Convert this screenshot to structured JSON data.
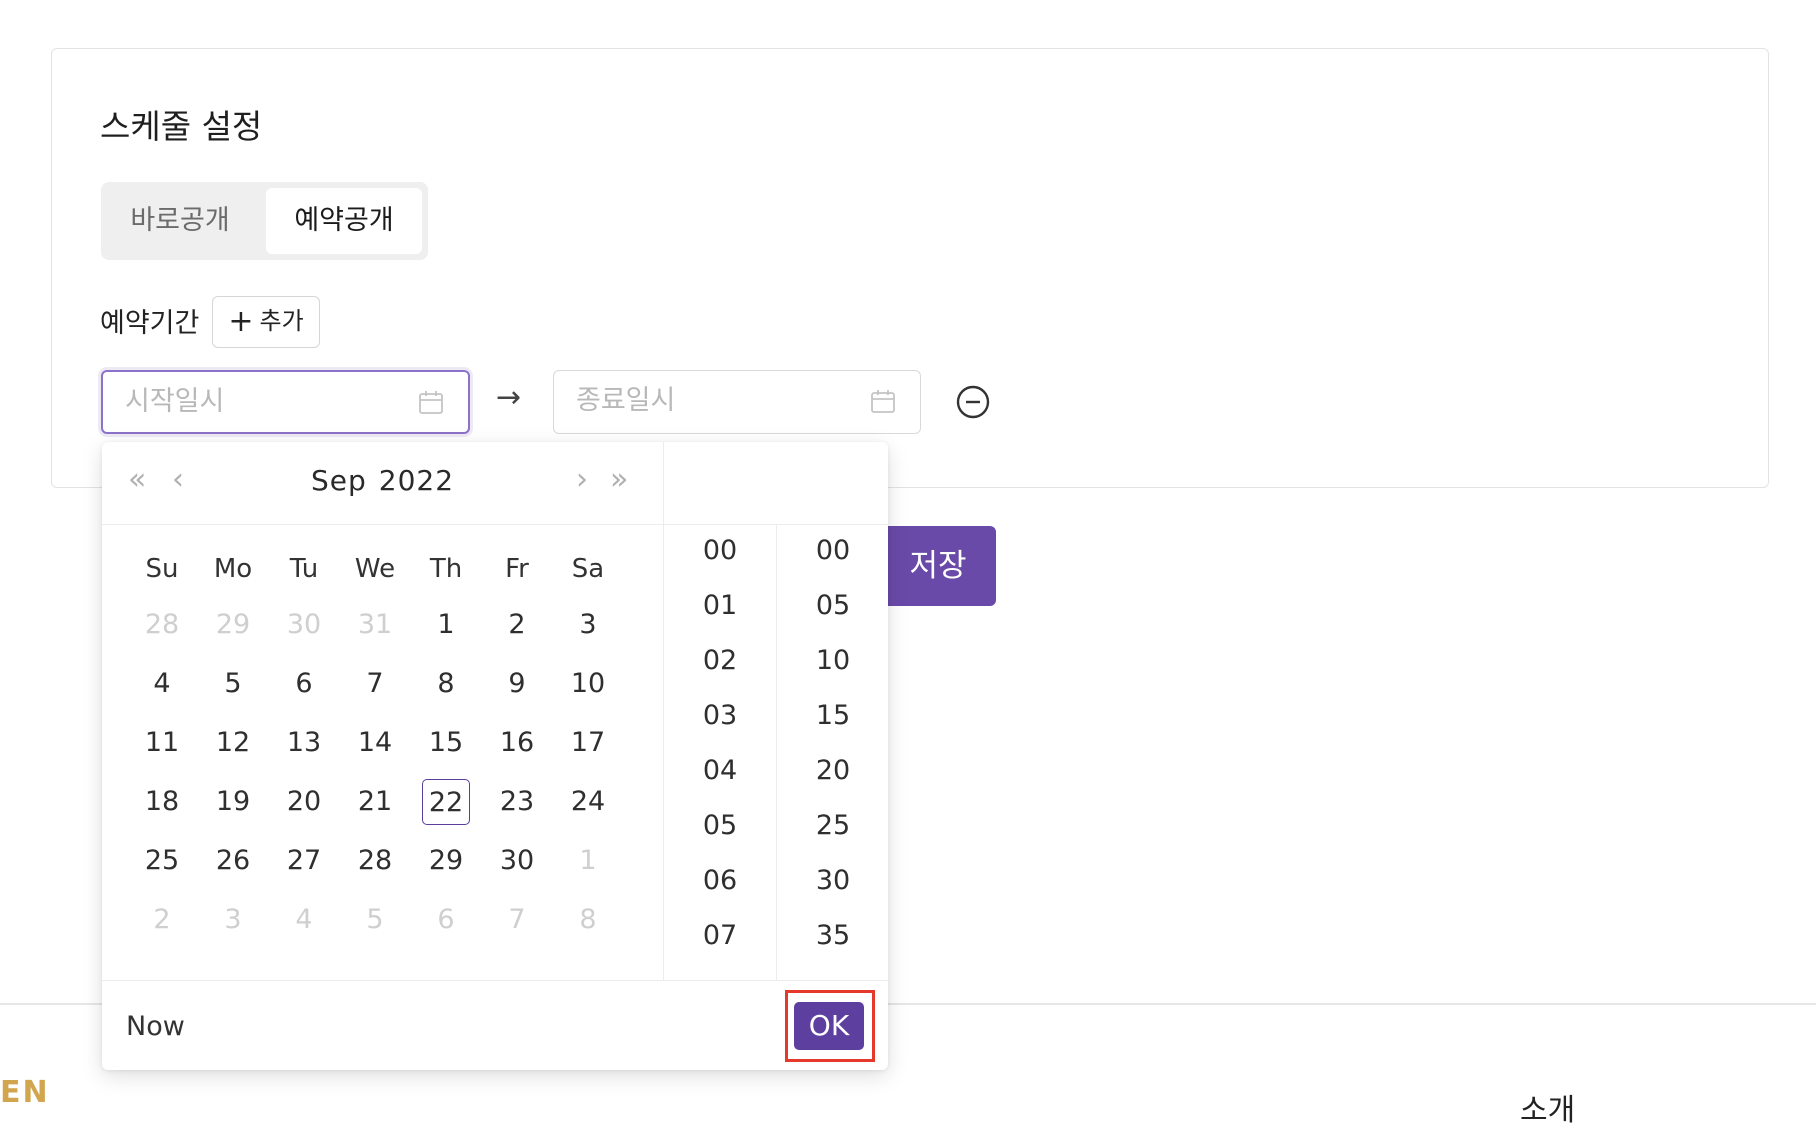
{
  "schedule": {
    "title": "스케줄 설정",
    "tabs": [
      {
        "label": "바로공개",
        "selected": false
      },
      {
        "label": "예약공개",
        "selected": true
      }
    ],
    "period_label": "예약기간",
    "add_button": {
      "icon": "plus-icon",
      "label": "추가"
    },
    "start_input": {
      "placeholder": "시작일시",
      "icon": "calendar-icon"
    },
    "range_separator": "→",
    "end_input": {
      "placeholder": "종료일시",
      "icon": "calendar-icon"
    },
    "remove_icon": "minus-circle-icon"
  },
  "save_button": {
    "label": "저장"
  },
  "picker": {
    "prev_year": "«",
    "prev_month": "‹",
    "month": "Sep",
    "year": "2022",
    "next_month": "›",
    "next_year": "»",
    "weekdays": [
      "Su",
      "Mo",
      "Tu",
      "We",
      "Th",
      "Fr",
      "Sa"
    ],
    "weeks": [
      [
        "28",
        "29",
        "30",
        "31",
        "1",
        "2",
        "3"
      ],
      [
        "4",
        "5",
        "6",
        "7",
        "8",
        "9",
        "10"
      ],
      [
        "11",
        "12",
        "13",
        "14",
        "15",
        "16",
        "17"
      ],
      [
        "18",
        "19",
        "20",
        "21",
        "22",
        "23",
        "24"
      ],
      [
        "25",
        "26",
        "27",
        "28",
        "29",
        "30",
        "1"
      ],
      [
        "2",
        "3",
        "4",
        "5",
        "6",
        "7",
        "8"
      ]
    ],
    "today": "22",
    "hours": [
      "00",
      "01",
      "02",
      "03",
      "04",
      "05",
      "06",
      "07"
    ],
    "minutes": [
      "00",
      "05",
      "10",
      "15",
      "20",
      "25",
      "30",
      "35"
    ],
    "now_label": "Now",
    "ok_label": "OK"
  },
  "colors": {
    "accent": "#6a4aa8",
    "highlight_box": "#e53a2b"
  },
  "footer": {
    "brand_fragment": "EN",
    "intro_fragment": "소개"
  }
}
